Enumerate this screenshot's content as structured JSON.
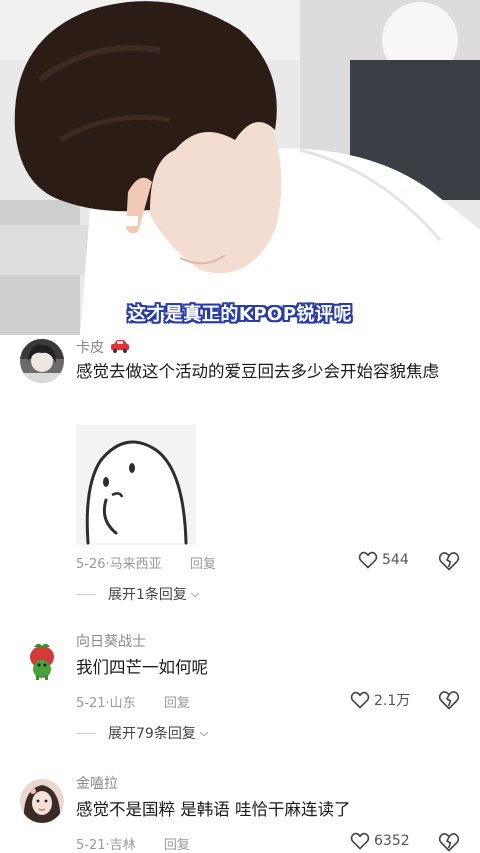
{
  "video": {
    "subtitle": "这才是真正的KPOP锐评呢"
  },
  "comments": [
    {
      "username": "卡皮",
      "badge_icon": "car-emoji-icon",
      "text": "感觉去做这个活动的爱豆回去多少会开始容貌焦虑",
      "date": "5-26",
      "location": "马来西亚",
      "reply_label": "回复",
      "likes": "544",
      "replies_label": "展开1条回复"
    },
    {
      "username": "向日葵战士",
      "text": "我们四芒一如何呢",
      "date": "5-21",
      "location": "山东",
      "reply_label": "回复",
      "likes": "2.1万",
      "replies_label": "展开79条回复"
    },
    {
      "username": "金嗑拉",
      "text": "感觉不是国粹 是韩语 哇恰干麻连读了",
      "date": "5-21",
      "location": "吉林",
      "reply_label": "回复",
      "likes": "6352"
    }
  ],
  "colors": {
    "subtitle_outline": "#2a3aa8",
    "muted_text": "#9a9a9a",
    "main_text": "#1a1a1a"
  }
}
